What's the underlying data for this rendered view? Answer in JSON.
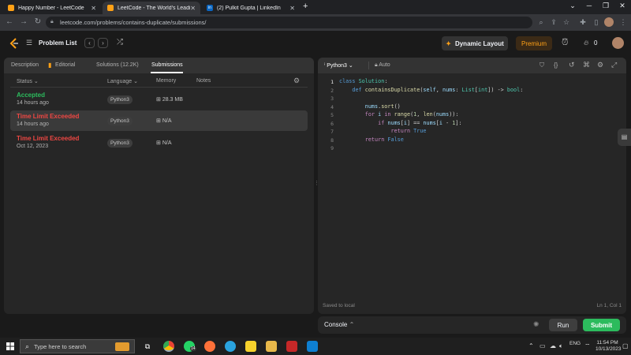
{
  "browser": {
    "tabs": [
      {
        "label": "Happy Number - LeetCode",
        "active": false
      },
      {
        "label": "LeetCode - The World's Leading",
        "active": true
      },
      {
        "label": "(2) Pulkit Gupta | LinkedIn",
        "active": false
      }
    ],
    "new_tab": "+",
    "url": "leetcode.com/problems/contains-duplicate/submissions/"
  },
  "header": {
    "problem_list": "Problem List",
    "dynamic_layout": "Dynamic Layout",
    "premium": "Premium",
    "streak_count": "0"
  },
  "left_panel": {
    "tabs": [
      "Description",
      "Editorial",
      "Solutions (12.2K)",
      "Submissions"
    ],
    "columns": {
      "status": "Status",
      "language": "Language",
      "memory": "Memory",
      "notes": "Notes"
    },
    "rows": [
      {
        "status": "Accepted",
        "time": "14 hours ago",
        "language": "Python3",
        "memory": "28.3 MB",
        "status_color": "#2cbb5d"
      },
      {
        "status": "Time Limit Exceeded",
        "time": "14 hours ago",
        "language": "Python3",
        "memory": "N/A",
        "status_color": "#ef4743"
      },
      {
        "status": "Time Limit Exceeded",
        "time": "Oct 12, 2023",
        "language": "Python3",
        "memory": "N/A",
        "status_color": "#ef4743"
      }
    ]
  },
  "editor": {
    "language": "Python3",
    "autocomplete": "Auto",
    "line_numbers": [
      "1",
      "2",
      "3",
      "4",
      "5",
      "6",
      "7",
      "8",
      "9"
    ],
    "saved": "Saved to local",
    "cursor": "Ln 1, Col 1"
  },
  "console": {
    "label": "Console",
    "run": "Run",
    "submit": "Submit"
  },
  "taskbar": {
    "search_placeholder": "Type here to search",
    "lang": "ENG",
    "lang_region": "IN",
    "time": "11:54 PM",
    "date": "10/13/2023",
    "whatsapp_badge": "14"
  },
  "colors": {
    "accepted": "#2cbb5d",
    "failed": "#ef4743",
    "submit_button": "#2cbb5d",
    "premium": "#ffa116"
  }
}
